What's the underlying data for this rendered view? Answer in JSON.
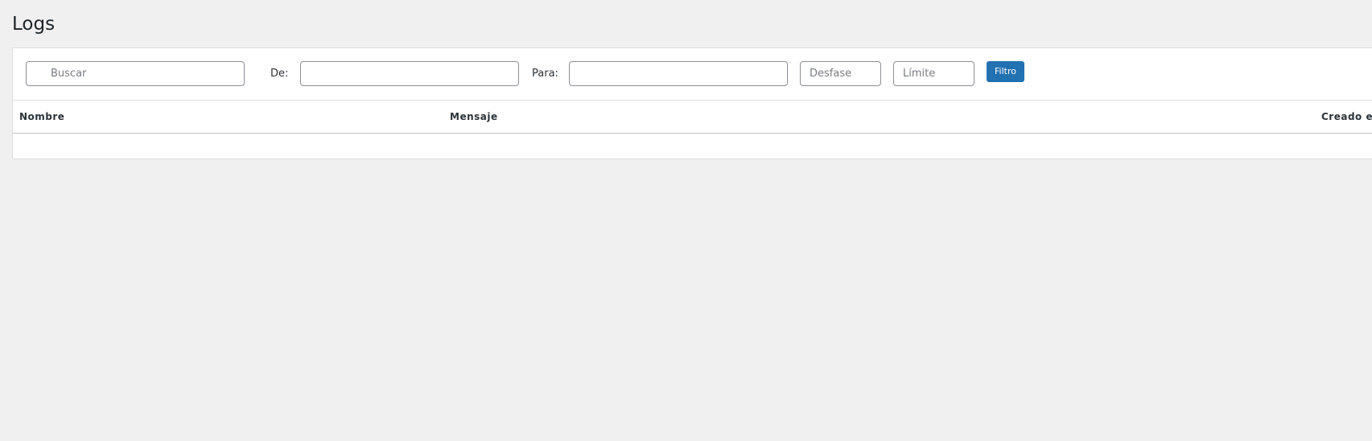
{
  "page": {
    "title": "Logs"
  },
  "filters": {
    "search_placeholder": "Buscar",
    "search_icon": "search-icon",
    "from_label": "De:",
    "from_value": "",
    "to_label": "Para:",
    "to_value": "",
    "offset_placeholder": "Desfase",
    "limit_placeholder": "Límite",
    "filter_button_label": "Filtro"
  },
  "table": {
    "columns": [
      "Nombre",
      "Mensaje",
      "Creado el"
    ],
    "rows": []
  },
  "colors": {
    "background": "#f0f0f1",
    "panel": "#ffffff",
    "accent": "#2271b1"
  }
}
